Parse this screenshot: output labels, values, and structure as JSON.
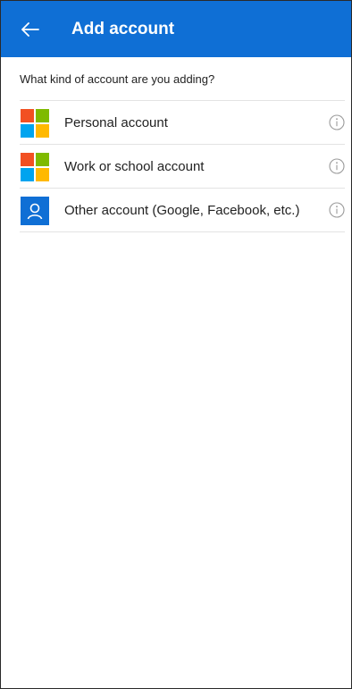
{
  "header": {
    "title": "Add account",
    "back_icon": "arrow-left-icon",
    "background_color": "#0f6fd5"
  },
  "prompt": "What kind of account are you adding?",
  "accounts": [
    {
      "label": "Personal account",
      "icon": "microsoft-logo-icon",
      "info_icon": "info-icon"
    },
    {
      "label": "Work or school account",
      "icon": "microsoft-logo-icon",
      "info_icon": "info-icon"
    },
    {
      "label": "Other account (Google, Facebook, etc.)",
      "icon": "person-icon",
      "info_icon": "info-icon"
    }
  ],
  "colors": {
    "ms_red": "#f25022",
    "ms_green": "#7fba00",
    "ms_blue": "#00a4ef",
    "ms_yellow": "#ffb900"
  }
}
